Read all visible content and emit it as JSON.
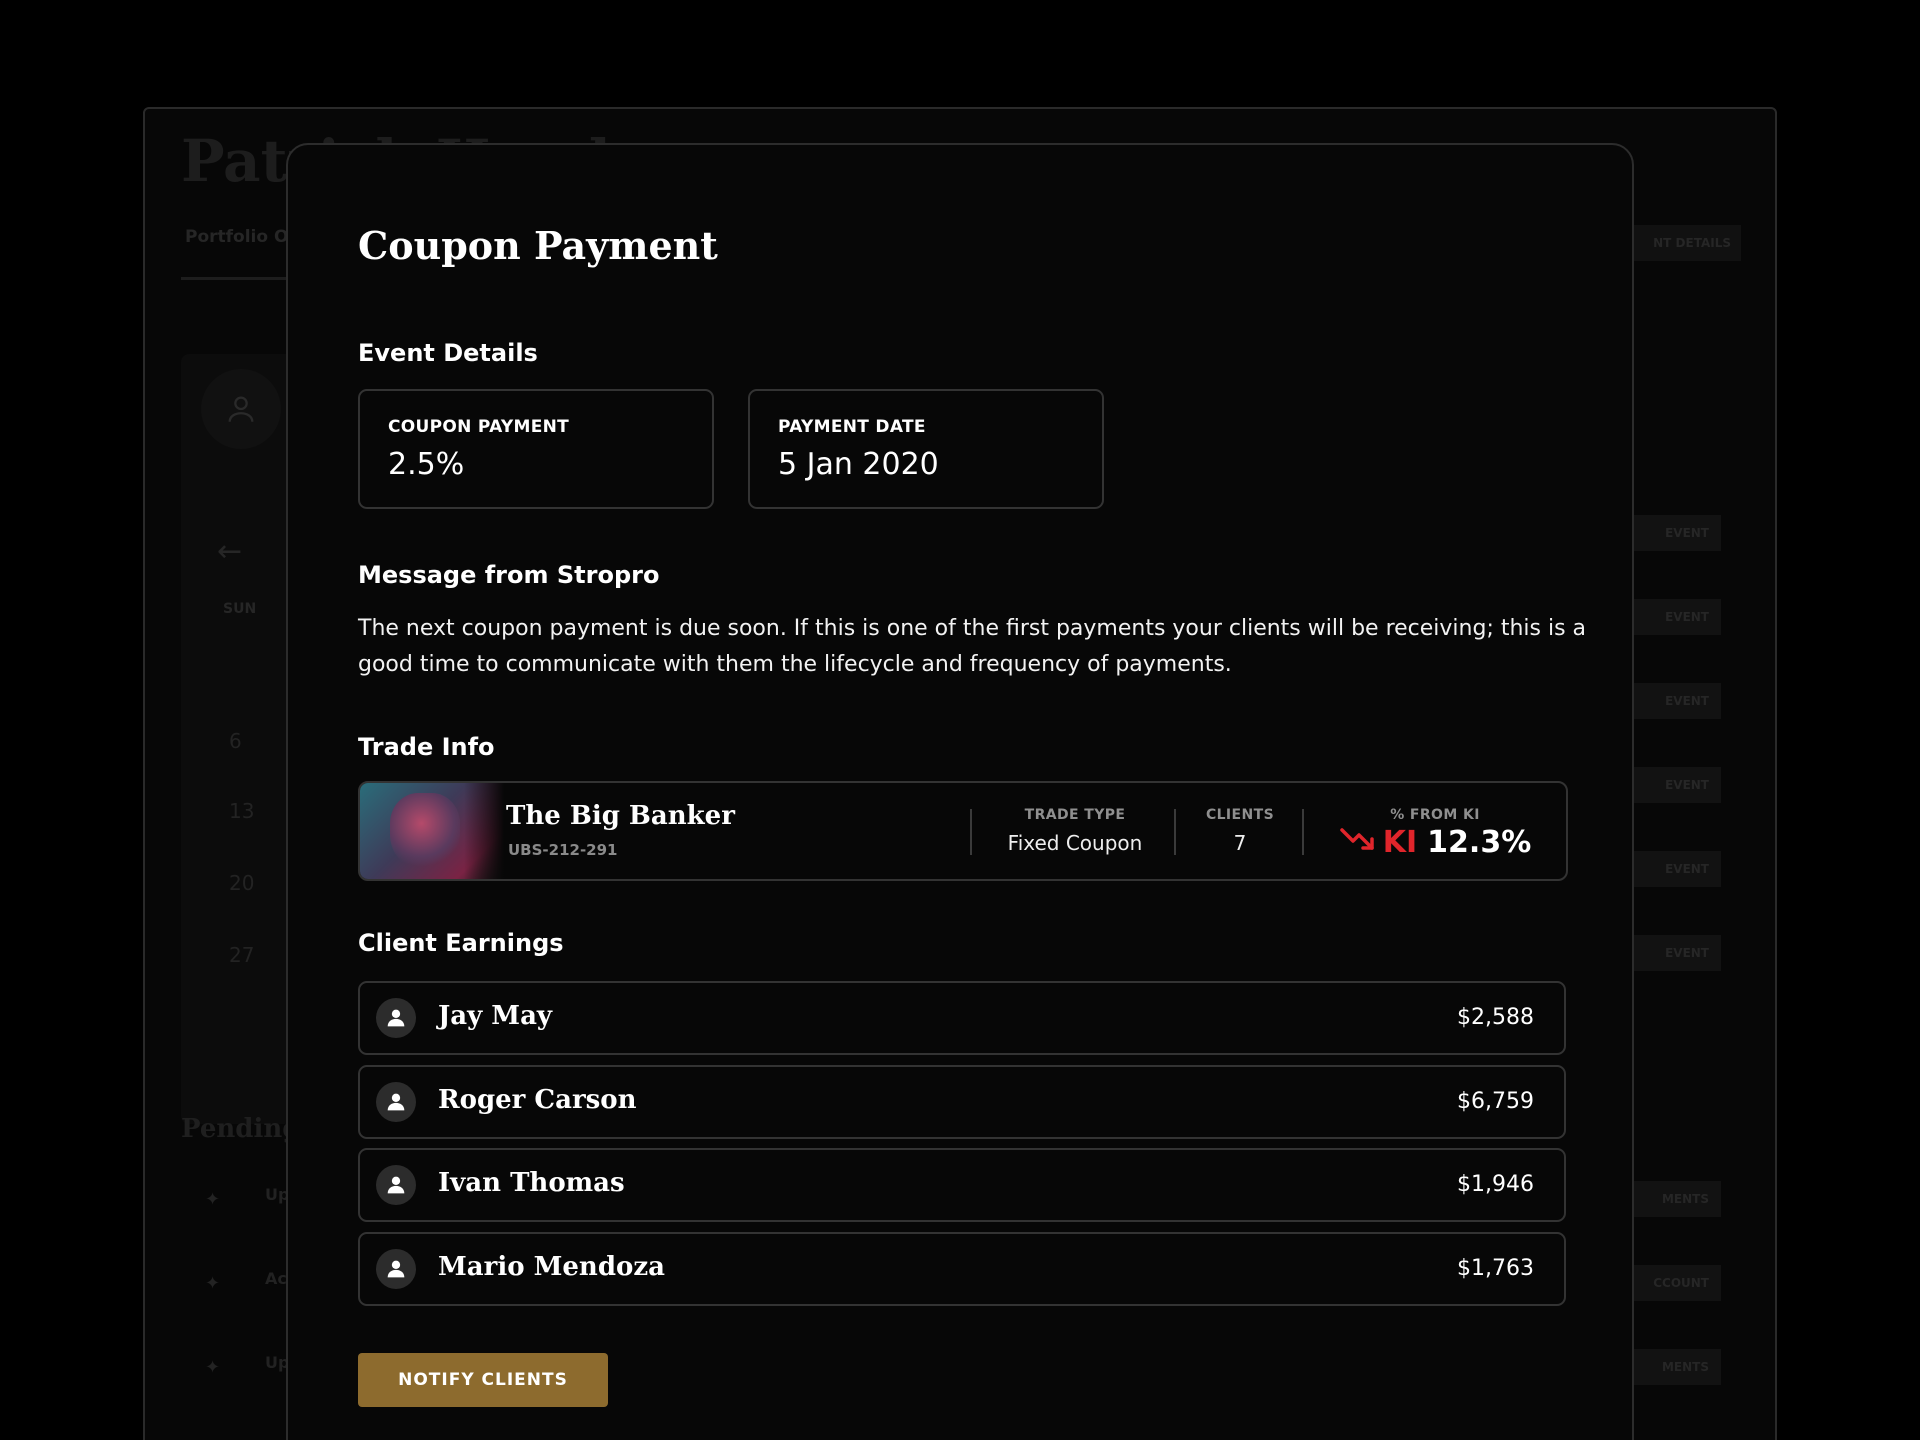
{
  "background": {
    "title": "Patrick Hand...",
    "tab": "Portfolio O",
    "right_tab": "NT DETAILS",
    "weekday": "SUN",
    "day_numbers": [
      "6",
      "13",
      "20",
      "27"
    ],
    "event_label": "EVENT",
    "pending_title": "Pending",
    "pending_items": [
      {
        "text": "Up",
        "action": "MENTS"
      },
      {
        "text": "Ac",
        "action": "CCOUNT"
      },
      {
        "text": "Up",
        "action": "MENTS"
      }
    ]
  },
  "modal": {
    "title": "Coupon Payment",
    "event_details": {
      "heading": "Event Details",
      "coupon_label": "COUPON PAYMENT",
      "coupon_value": "2.5%",
      "date_label": "PAYMENT DATE",
      "date_value": "5 Jan 2020"
    },
    "message": {
      "heading": "Message from Stropro",
      "body": "The next coupon payment is due soon. If this is one of the first payments your clients will be receiving; this is a good time to communicate with them the lifecycle and frequency of payments."
    },
    "trade": {
      "heading": "Trade Info",
      "name": "The Big Banker",
      "code": "UBS-212-291",
      "trade_type_label": "TRADE TYPE",
      "trade_type_value": "Fixed Coupon",
      "clients_label": "CLIENTS",
      "clients_value": "7",
      "ki_label": "% FROM KI",
      "ki_tag": "KI",
      "ki_value": "12.3%"
    },
    "earnings": {
      "heading": "Client Earnings",
      "clients": [
        {
          "name": "Jay May",
          "amount": "$2,588"
        },
        {
          "name": "Roger Carson",
          "amount": "$6,759"
        },
        {
          "name": "Ivan Thomas",
          "amount": "$1,946"
        },
        {
          "name": "Mario Mendoza",
          "amount": "$1,763"
        }
      ]
    },
    "notify_label": "NOTIFY CLIENTS"
  },
  "colors": {
    "accent": "#8d6b2e",
    "negative": "#e0252b",
    "background": "#000000"
  },
  "icons": {
    "ki_trend": "trending-down-icon",
    "client": "user-icon"
  }
}
